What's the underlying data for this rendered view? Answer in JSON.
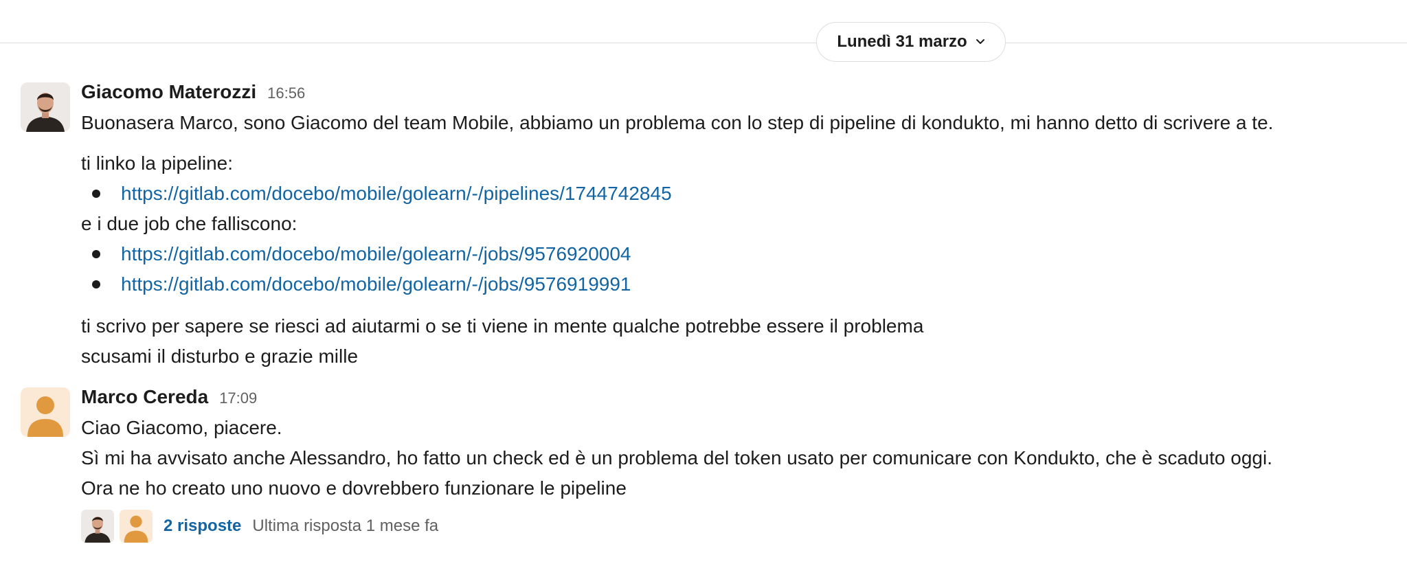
{
  "date_divider": {
    "label": "Lunedì 31 marzo",
    "icon": "chevron-down-icon"
  },
  "messages": [
    {
      "sender": "Giacomo Materozzi",
      "time": "16:56",
      "avatar": "photo-avatar",
      "lines": [
        "Buonasera Marco, sono Giacomo del team Mobile, abbiamo un problema con lo step di pipeline di kondukto, mi hanno detto di scrivere a te.",
        "ti linko la pipeline:",
        "e i due job che falliscono:",
        "ti scrivo per sapere se riesci ad aiutarmi o se ti viene in mente qualche potrebbe essere il problema",
        "scusami il disturbo e grazie mille"
      ],
      "pipeline_links": [
        "https://gitlab.com/docebo/mobile/golearn/-/pipelines/1744742845"
      ],
      "job_links": [
        "https://gitlab.com/docebo/mobile/golearn/-/jobs/9576920004",
        "https://gitlab.com/docebo/mobile/golearn/-/jobs/9576919991"
      ]
    },
    {
      "sender": "Marco Cereda",
      "time": "17:09",
      "avatar": "default-user-avatar",
      "lines": [
        "Ciao Giacomo, piacere.",
        "Sì mi ha avvisato anche Alessandro, ho fatto un check ed è un problema del token usato per comunicare con Kondukto, che è scaduto oggi.",
        "Ora ne ho creato uno nuovo e dovrebbero funzionare le pipeline"
      ],
      "thread": {
        "replies_label": "2 risposte",
        "last_reply_label": "Ultima risposta 1 mese fa"
      }
    }
  ],
  "colors": {
    "link": "#1264a3",
    "text": "#1d1c1d",
    "muted": "#616061",
    "default_avatar_bg": "#fbe9d6",
    "default_avatar_fg": "#e0993f"
  }
}
